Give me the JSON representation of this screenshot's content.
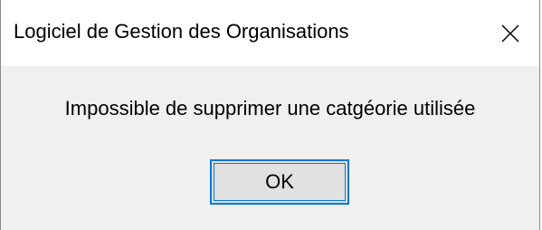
{
  "window": {
    "title": "Logiciel de Gestion des Organisations",
    "close_icon": "close-icon"
  },
  "message": {
    "text": "Impossible de supprimer une catgéorie utilisée"
  },
  "buttons": {
    "ok_label": "OK"
  },
  "colors": {
    "accent": "#0078d7",
    "content_background": "#f0f0f0",
    "titlebar_background": "#ffffff",
    "button_background": "#e1e1e1"
  }
}
